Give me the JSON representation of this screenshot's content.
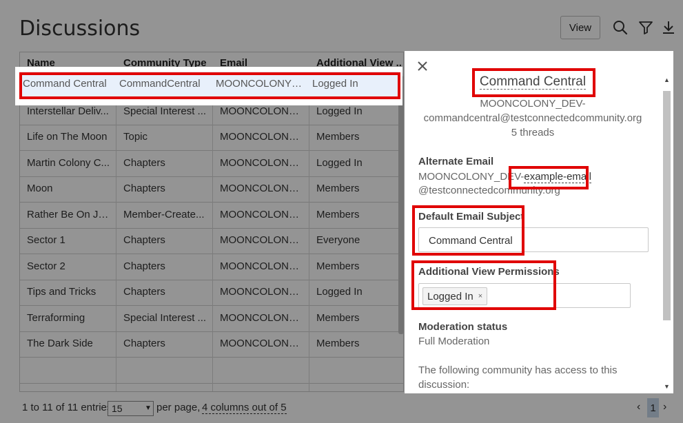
{
  "page_title": "Discussions",
  "toolbar": {
    "view_label": "View",
    "icons": [
      "search-icon",
      "filter-icon",
      "download-icon"
    ]
  },
  "table": {
    "columns": [
      "Name",
      "Community Type",
      "Email",
      "Additional View ..."
    ],
    "rows": [
      [
        "Command Central",
        "CommandCentral",
        "MOONCOLONY_...",
        "Logged In"
      ],
      [
        "Interstellar Deliv...",
        "Special Interest ...",
        "MOONCOLONY_...",
        "Logged In"
      ],
      [
        "Life on The Moon",
        "Topic",
        "MOONCOLONY_...",
        "Members"
      ],
      [
        "Martin Colony C...",
        "Chapters",
        "MOONCOLONY_...",
        "Logged In"
      ],
      [
        "Moon",
        "Chapters",
        "MOONCOLONY_...",
        "Members"
      ],
      [
        "Rather Be On Ju...",
        "Member-Create...",
        "MOONCOLONY_...",
        "Members"
      ],
      [
        "Sector 1",
        "Chapters",
        "MOONCOLONY_...",
        "Everyone"
      ],
      [
        "Sector 2",
        "Chapters",
        "MOONCOLONY_...",
        "Members"
      ],
      [
        "Tips and Tricks",
        "Chapters",
        "MOONCOLONY_...",
        "Logged In"
      ],
      [
        "Terraforming",
        "Special Interest ...",
        "MOONCOLONY_...",
        "Members"
      ],
      [
        "The Dark Side",
        "Chapters",
        "MOONCOLONY_...",
        "Members"
      ]
    ]
  },
  "footer": {
    "entries_text": "1 to 11 of 11 entries,",
    "per_page_value": "15",
    "per_page_text": "per page,",
    "columns_text": "4 columns out of 5",
    "current_page": "1"
  },
  "panel": {
    "title": "Command Central",
    "email_line1": "MOONCOLONY_DEV-",
    "email_line2": "commandcentral@testconnectedcommunity.org",
    "threads": "5 threads",
    "alternate_email_label": "Alternate Email",
    "alternate_email_prefix": "MOONCOLONY_DEV-",
    "alternate_email_link": "example-email",
    "alternate_email_domain": "@testconnectedcommunity.org",
    "default_subject_label": "Default Email Subject",
    "default_subject_value": "Command Central",
    "view_permissions_label": "Additional View Permissions",
    "view_permissions_tag": "Logged In",
    "tag_remove": "×",
    "moderation_label": "Moderation status",
    "moderation_value": "Full Moderation",
    "access_text_line1": "The following community has access to this",
    "access_text_line2": "discussion:"
  },
  "colors": {
    "highlight": "#e00000",
    "selected_row": "#e8f0fb",
    "pager_active": "#c7d7ea"
  }
}
